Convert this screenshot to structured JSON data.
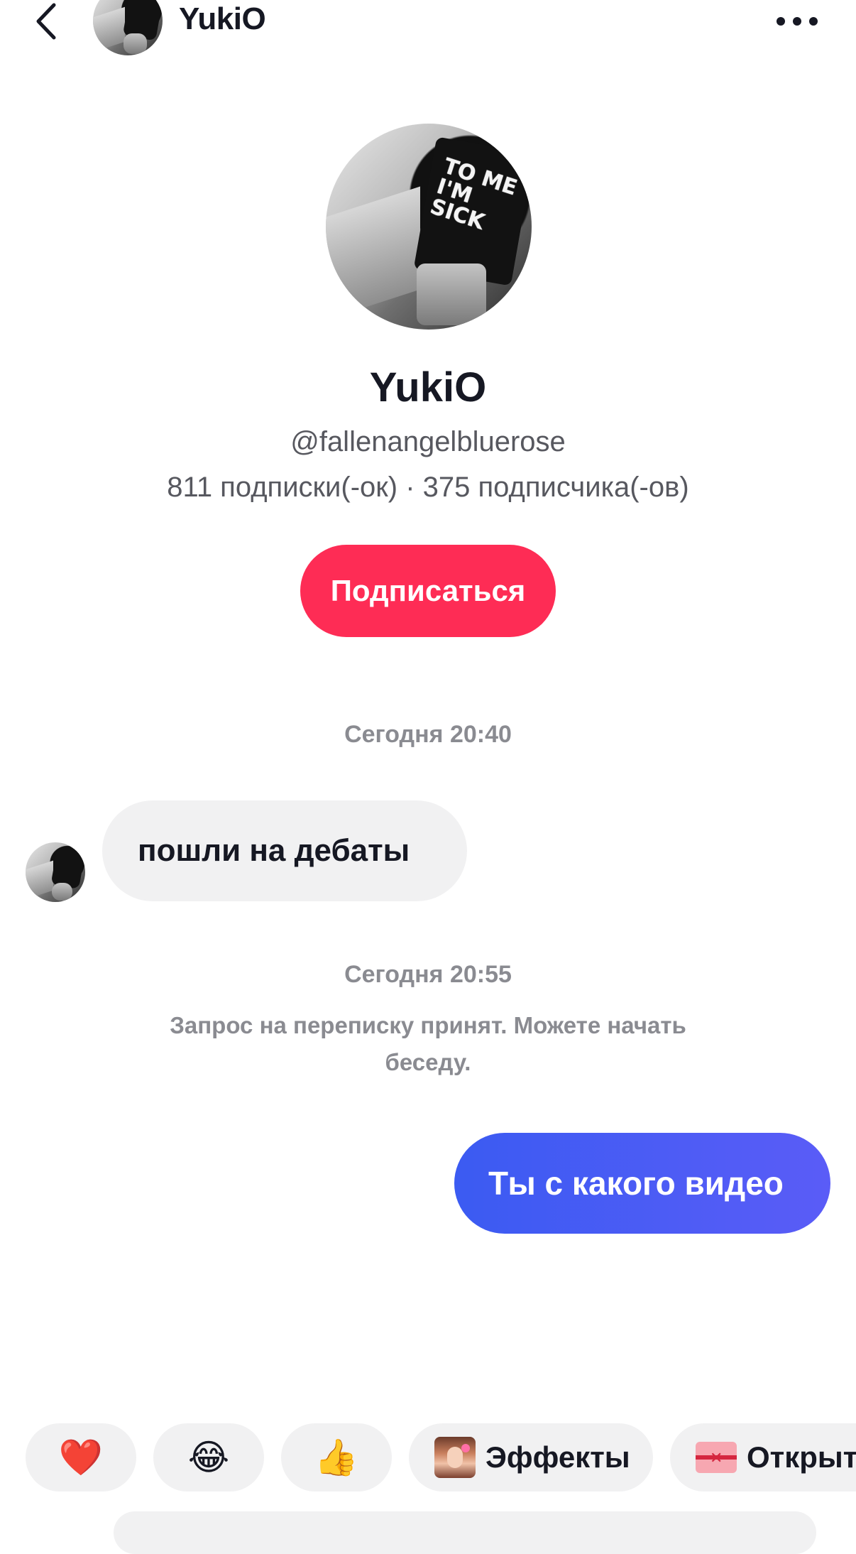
{
  "header": {
    "name": "YukiO",
    "back_icon": "chevron-left-icon",
    "more_icon": "more-horizontal-icon"
  },
  "profile": {
    "name": "YukiO",
    "username": "@fallenangelbluerose",
    "stats": "811 подписки(-ок) · 375 подписчика(-ов)",
    "follow_label": "Подписаться",
    "avatar_shirt_text": "TO ME I'M SICK"
  },
  "chat": {
    "timestamp_1": "Сегодня 20:40",
    "incoming_message": "пошли на дебаты",
    "timestamp_2": "Сегодня 20:55",
    "system_note": "Запрос на переписку принят. Можете начать беседу.",
    "outgoing_message": "Ты с какого видео"
  },
  "quick_bar": {
    "heart": "❤️",
    "laugh": "😂",
    "thumbs_up": "👍",
    "effects_label": "Эффекты",
    "cards_label": "Открыт"
  },
  "colors": {
    "follow_button": "#fe2c55",
    "outgoing_bubble": "#3b5bf2",
    "incoming_bubble": "#f1f1f2"
  }
}
